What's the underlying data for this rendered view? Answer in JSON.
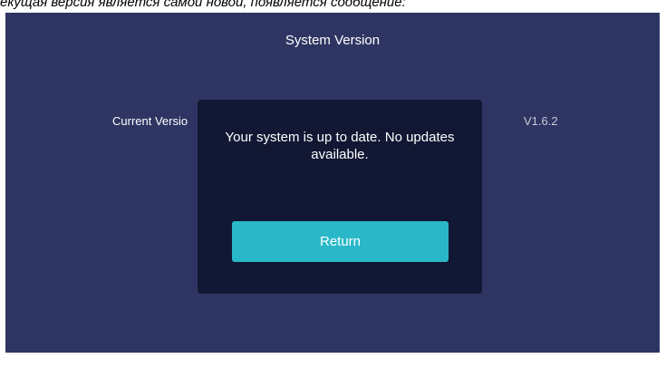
{
  "caption": "екущая версия является самой новой, появляется сообщение:",
  "screen": {
    "title": "System Version",
    "current_version_label": "Current Versio",
    "current_version_value": "V1.6.2"
  },
  "dialog": {
    "message": "Your system is up to date. No updates available.",
    "button_label": "Return"
  },
  "colors": {
    "screen_bg": "#2e3562",
    "dialog_bg": "#121733",
    "button_bg": "#2ab8c9",
    "text": "#ffffff"
  }
}
